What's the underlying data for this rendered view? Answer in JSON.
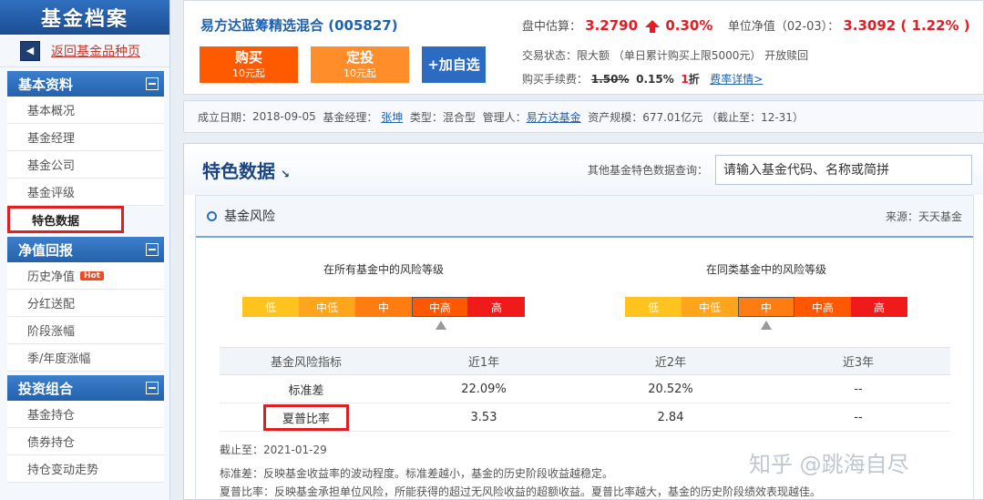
{
  "sidebar": {
    "logo": "基金档案",
    "back": "返回基金品种页",
    "sections": [
      {
        "title": "基本资料",
        "items": [
          "基本概况",
          "基金经理",
          "基金公司",
          "基金评级",
          "特色数据"
        ]
      },
      {
        "title": "净值回报",
        "items": [
          "历史净值",
          "分红送配",
          "阶段涨幅",
          "季/年度涨幅"
        ],
        "hot": "Hot"
      },
      {
        "title": "投资组合",
        "items": [
          "基金持仓",
          "债券持仓",
          "持仓变动走势"
        ]
      }
    ]
  },
  "fund": {
    "name": "易方达蓝筹精选混合 (005827)",
    "buy_label": "购买",
    "buy_sub": "10元起",
    "fixed_label": "定投",
    "fixed_sub": "10元起",
    "add_label": "+加自选",
    "estimate_label": "盘中估算：",
    "estimate_value": "3.2790",
    "estimate_change": "0.30%",
    "nav_label": "单位净值（02-03）：",
    "nav_value": "3.3092 ( 1.22% )",
    "trade_status": "交易状态：限大额 （单日累计购买上限5000元） 开放赎回",
    "fee_label": "购买手续费：",
    "fee_old": "1.50%",
    "fee_new": "0.15%",
    "fee_discount_num": "1",
    "fee_discount_text": "折",
    "fee_link": "费率详情>"
  },
  "meta": {
    "established_label": "成立日期：",
    "established": "2018-09-05",
    "manager_label": "基金经理：",
    "manager": "张坤",
    "type_label": "类型：",
    "type": "混合型",
    "company_label": "管理人：",
    "company": "易方达基金",
    "size_label": "资产规模：",
    "size": "677.01亿元 （截止至：12-31）"
  },
  "main": {
    "title": "特色数据",
    "title_arrow": "↘",
    "search_label": "其他基金特色数据查询：",
    "search_value": "请输入基金代码、名称或简拼",
    "box_title": "基金风险",
    "source": "来源：天天基金",
    "risk_all_label": "在所有基金中的风险等级",
    "risk_same_label": "在同类基金中的风险等级",
    "levels": [
      "低",
      "中低",
      "中",
      "中高",
      "高"
    ],
    "level_colors": [
      "#ffc31f",
      "#ffa51c",
      "#ff7d10",
      "#ff5800",
      "#f01a1a"
    ],
    "table": {
      "headers": [
        "基金风险指标",
        "近1年",
        "近2年",
        "近3年"
      ],
      "rows": [
        [
          "标准差",
          "22.09%",
          "20.52%",
          "--"
        ],
        [
          "夏普比率",
          "3.53",
          "2.84",
          "--"
        ]
      ]
    },
    "as_of": "截止至：2021-01-29",
    "note1": "标准差：反映基金收益率的波动程度。标准差越小，基金的历史阶段收益越稳定。",
    "note2": "夏普比率：反映基金承担单位风险，所能获得的超过无风险收益的超额收益。夏普比率越大，基金的历史阶段绩效表现越佳。"
  },
  "watermark": "知乎 @跳海自尽"
}
